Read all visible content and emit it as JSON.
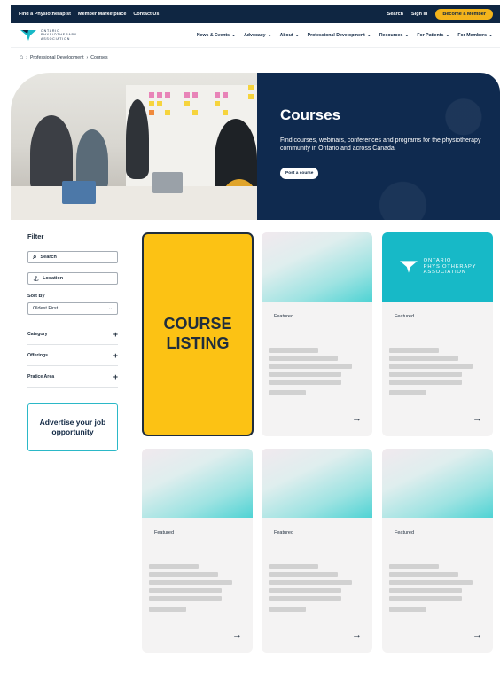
{
  "topbar": {
    "links": [
      "Find a Physiotherapist",
      "Member Marketplace",
      "Contact Us"
    ],
    "search": "Search",
    "sign_in": "Sign In",
    "become_member": "Become a Member"
  },
  "logo": {
    "lines": [
      "ONTARIO",
      "PHYSIOTHERAPY",
      "ASSOCIATION"
    ]
  },
  "nav": [
    "News & Events",
    "Advocacy",
    "About",
    "Professional Development",
    "Resources",
    "For Patients",
    "For Members"
  ],
  "breadcrumb": [
    "Professional Development",
    "Courses"
  ],
  "hero": {
    "title": "Courses",
    "description": "Find courses, webinars, conferences and programs for the physiotherapy community in Ontario and across Canada.",
    "button": "Post a course"
  },
  "filter": {
    "title": "Filter",
    "search_placeholder": "Search",
    "location_placeholder": "Location",
    "sort_label": "Sort By",
    "sort_value": "Oldest First",
    "accordions": [
      "Category",
      "Offerings",
      "Pratice Area"
    ],
    "advert": "Advertise your job opportunity"
  },
  "listing": {
    "line1": "COURSE",
    "line2": "LISTING"
  },
  "cards": [
    {
      "badge": "Featured"
    },
    {
      "badge": "Featured"
    },
    {
      "badge": "Featured"
    },
    {
      "badge": "Featured"
    },
    {
      "badge": "Featured"
    }
  ],
  "icons": {
    "arrow": "arrow-right-icon",
    "home": "home-icon",
    "chevron": "chevron-down-icon"
  },
  "colors": {
    "navy": "#0f2642",
    "gold": "#fcc214",
    "teal": "#17b9c7"
  }
}
